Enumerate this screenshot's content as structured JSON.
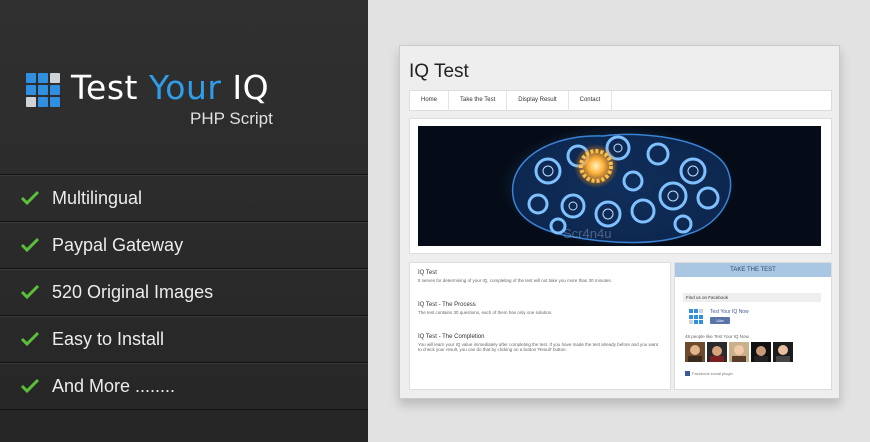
{
  "banner": {
    "title_part1": "Test ",
    "title_part2": "Your",
    "title_part3": " IQ",
    "subtitle": "PHP Script",
    "features": [
      "Multilingual",
      "Paypal Gateway",
      "520 Original Images",
      "Easy to Install",
      "And More ........"
    ],
    "colors": {
      "accent": "#2f9de8",
      "check": "#5bbf3a",
      "panel": "#2b2b2b"
    }
  },
  "mockup": {
    "title": "IQ Test",
    "nav": [
      "Home",
      "Take the Test",
      "Display Result",
      "Contact"
    ],
    "hero": {
      "watermark": "Scr4n4u"
    },
    "content": {
      "sections": [
        {
          "heading": "IQ Test",
          "text": "It serves for determining of your IQ, completing of the test will not take you more than 30 minutes."
        },
        {
          "heading": "IQ Test - The Process",
          "text": "The test contains 30 questions, each of them has only one solution."
        },
        {
          "heading": "IQ Test - The Completion",
          "text": "You will learn your IQ value immediately after completing the test. If you have made the test already before and you want to check your result, you can do that by clicking on a button 'Result' button."
        }
      ]
    },
    "sidebar": {
      "take_test": "TAKE THE TEST",
      "find_fb": "Find us on Facebook",
      "page_name": "Test Your IQ Now",
      "like": "Like",
      "people_like": "48 people like Test Your IQ Now.",
      "plugin": "Facebook social plugin"
    }
  }
}
